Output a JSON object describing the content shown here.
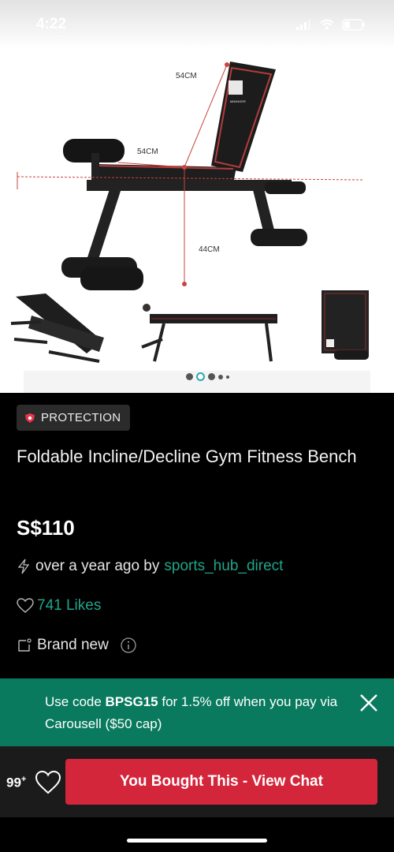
{
  "status_bar": {
    "time": "4:22",
    "icons": [
      "signal-icon",
      "wifi-icon",
      "battery-icon"
    ]
  },
  "nav": {
    "icons": [
      "back-arrow-icon",
      "share-icon",
      "flag-icon"
    ]
  },
  "gallery": {
    "image_labels": {
      "back_width": "54CM",
      "seat_width": "54CM",
      "height": "44CM",
      "brand": "MIKINGER"
    },
    "page_count": 5,
    "active_page": 1
  },
  "listing": {
    "badge": "PROTECTION",
    "title": "Foldable Incline/Decline Gym Fitness Bench",
    "price": "S$110",
    "posted": "over a year ago by",
    "seller": "sports_hub_direct",
    "likes": "741 Likes",
    "condition": "Brand new"
  },
  "promo": {
    "prefix": "Use code ",
    "code": "BPSG15",
    "suffix": " for 1.5% off when you pay via Carousell ($50 cap)"
  },
  "bottom_bar": {
    "like_count": "99",
    "like_count_suffix": "+",
    "chat_button": "You Bought This - View Chat"
  },
  "colors": {
    "accent_green": "#1fa58a",
    "promo_bg": "#097a5e",
    "button_red": "#d4263b",
    "badge_bg": "#2b2b2b"
  }
}
